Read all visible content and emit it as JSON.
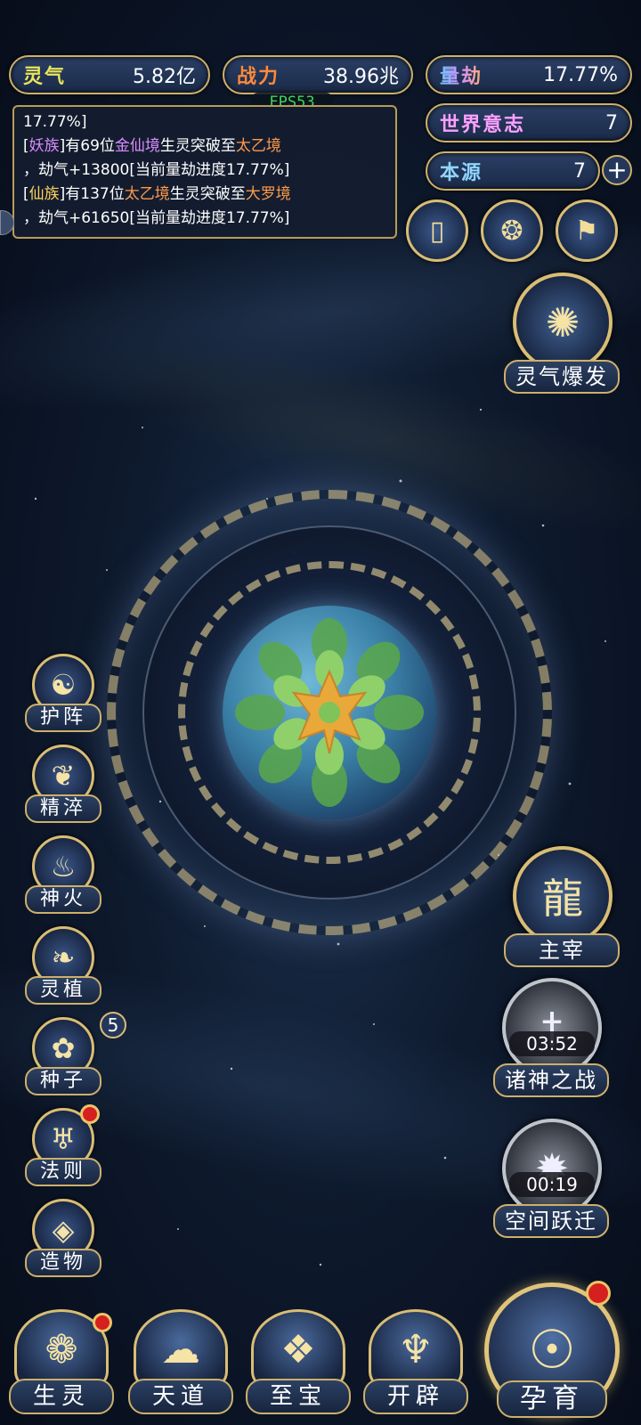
{
  "top_stats": {
    "lingqi": {
      "label": "灵气",
      "value": "5.82亿"
    },
    "zhanli": {
      "label": "战力",
      "value": "38.96兆"
    },
    "liangjie": {
      "label": "量劫",
      "value": "17.77%"
    },
    "world_will": {
      "label": "世界意志",
      "value": "7"
    },
    "benyuan": {
      "label": "本源",
      "value": "7",
      "plus": "+"
    }
  },
  "fps": "FPS53",
  "log": {
    "line0": "17.77%]",
    "e1": {
      "open": "[",
      "faction": "妖族",
      "mid1": "]有69位",
      "realm1": "金仙境",
      "mid2": "生灵突破至",
      "realm2": "太乙境",
      "tail": "，劫气+13800[当前量劫进度17.77%]"
    },
    "e2": {
      "open": "[",
      "faction": "仙族",
      "mid1": "]有137位",
      "realm1": "太乙境",
      "mid2": "生灵突破至",
      "realm2": "大罗境",
      "tail": "，劫气+61650[当前量劫进度17.77%]"
    }
  },
  "burst_button": {
    "label": "灵气爆发"
  },
  "side_buttons": [
    {
      "label": "护阵"
    },
    {
      "label": "精淬"
    },
    {
      "label": "神火"
    },
    {
      "label": "灵植"
    },
    {
      "label": "种子",
      "badge": "5"
    },
    {
      "label": "法则"
    },
    {
      "label": "造物"
    }
  ],
  "right_buttons": {
    "zhuzai": {
      "label": "主宰"
    },
    "zhushen": {
      "label": "诸神之战",
      "timer": "03:52"
    },
    "kongjian": {
      "label": "空间跃迁",
      "timer": "00:19"
    }
  },
  "bottom_nav": [
    {
      "label": "生灵"
    },
    {
      "label": "天道"
    },
    {
      "label": "至宝"
    },
    {
      "label": "开辟"
    }
  ],
  "main_button": {
    "label": "孕育"
  },
  "colors": {
    "gold": "#d9bd74",
    "panel": "#1a2a48",
    "notify": "#d61f1f"
  }
}
